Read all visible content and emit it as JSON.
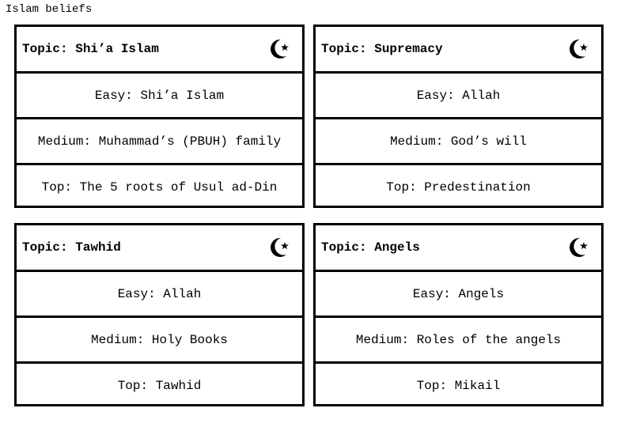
{
  "document": {
    "title": "Islam beliefs"
  },
  "cards": [
    {
      "topic": "Topic: Shi’a Islam",
      "icon": "crescent-star-icon",
      "easy": "Easy: Shi’a Islam",
      "medium": "Medium: Muhammad’s (PBUH) family",
      "top": "Top: The 5 roots of Usul ad-Din"
    },
    {
      "topic": "Topic: Supremacy",
      "icon": "crescent-star-icon",
      "easy": "Easy: Allah",
      "medium": "Medium: God’s will",
      "top": "Top: Predestination"
    },
    {
      "topic": "Topic: Tawhid",
      "icon": "crescent-star-icon",
      "easy": "Easy: Allah",
      "medium": "Medium: Holy Books",
      "top": "Top: Tawhid"
    },
    {
      "topic": "Topic: Angels",
      "icon": "crescent-star-icon",
      "easy": "Easy: Angels",
      "medium": "Medium: Roles of the angels",
      "top": "Top: Mikail"
    }
  ]
}
